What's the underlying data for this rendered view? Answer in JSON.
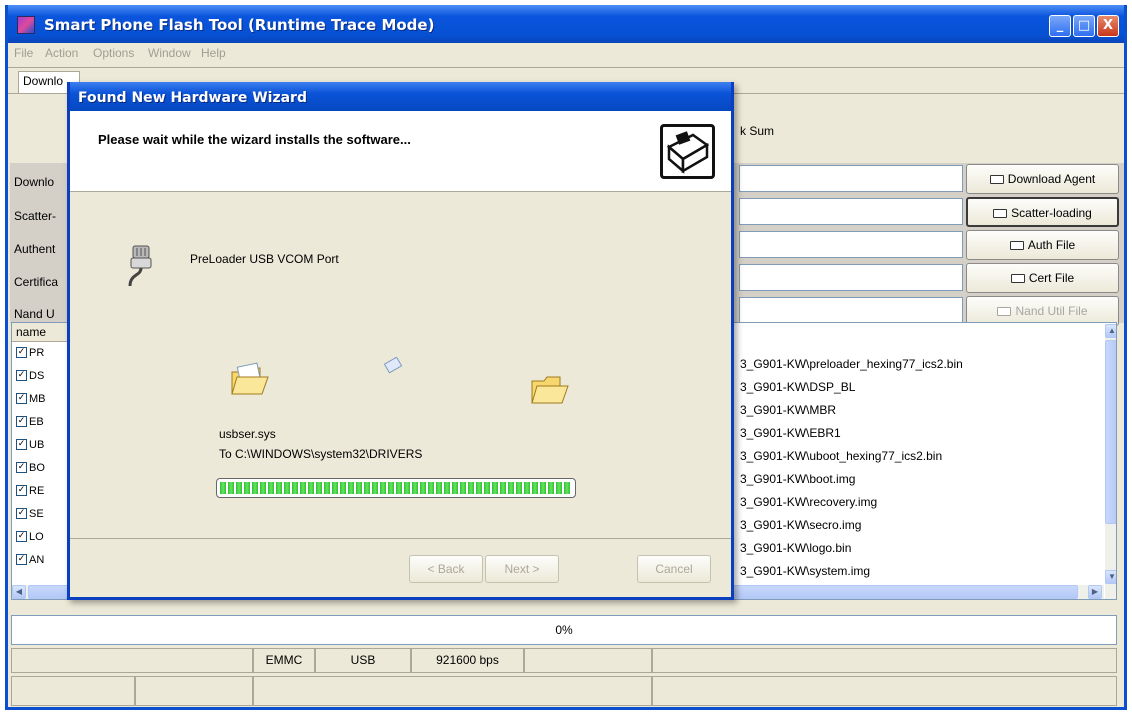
{
  "window": {
    "title": "Smart Phone Flash Tool (Runtime Trace Mode)",
    "minimize_label": "_",
    "maximize_label": "□",
    "close_label": "X"
  },
  "menu": [
    "File",
    "Action",
    "Options",
    "Window",
    "Help"
  ],
  "tab_label": "Downlo",
  "checksum_label": "k Sum",
  "field_labels": [
    "Downlo",
    "Scatter-",
    "Authent",
    "Certifica",
    "Nand U"
  ],
  "buttons": {
    "download_agent": "Download Agent",
    "scatter_loading": "Scatter-loading",
    "auth_file": "Auth File",
    "cert_file": "Cert File",
    "nand_util_file": "Nand Util File"
  },
  "list": {
    "name_header": "name",
    "names": [
      "PR",
      "DS",
      "MB",
      "EB",
      "UB",
      "BO",
      "RE",
      "SE",
      "LO",
      "AN"
    ],
    "paths": [
      "3_G901-KW\\preloader_hexing77_ics2.bin",
      "3_G901-KW\\DSP_BL",
      "3_G901-KW\\MBR",
      "3_G901-KW\\EBR1",
      "3_G901-KW\\uboot_hexing77_ics2.bin",
      "3_G901-KW\\boot.img",
      "3_G901-KW\\recovery.img",
      "3_G901-KW\\secro.img",
      "3_G901-KW\\logo.bin",
      "3_G901-KW\\system.img"
    ],
    "check_glyph": "✓"
  },
  "progress": {
    "text": "0%",
    "value": 0
  },
  "status": {
    "storage": "EMMC",
    "port": "USB",
    "baud": "921600 bps"
  },
  "dialog": {
    "title": "Found New Hardware Wizard",
    "heading": "Please wait while the wizard installs the software...",
    "device": "PreLoader USB VCOM Port",
    "file": "usbser.sys",
    "destination": "To C:\\WINDOWS\\system32\\DRIVERS",
    "progress": 1.0,
    "back": "< Back",
    "next": "Next >",
    "cancel": "Cancel"
  },
  "icons": [
    "app-icon",
    "usb-plug-icon",
    "folder-source-icon",
    "flying-paper-icon",
    "folder-destination-icon",
    "hardware-wizard-icon",
    "folder-icon"
  ]
}
